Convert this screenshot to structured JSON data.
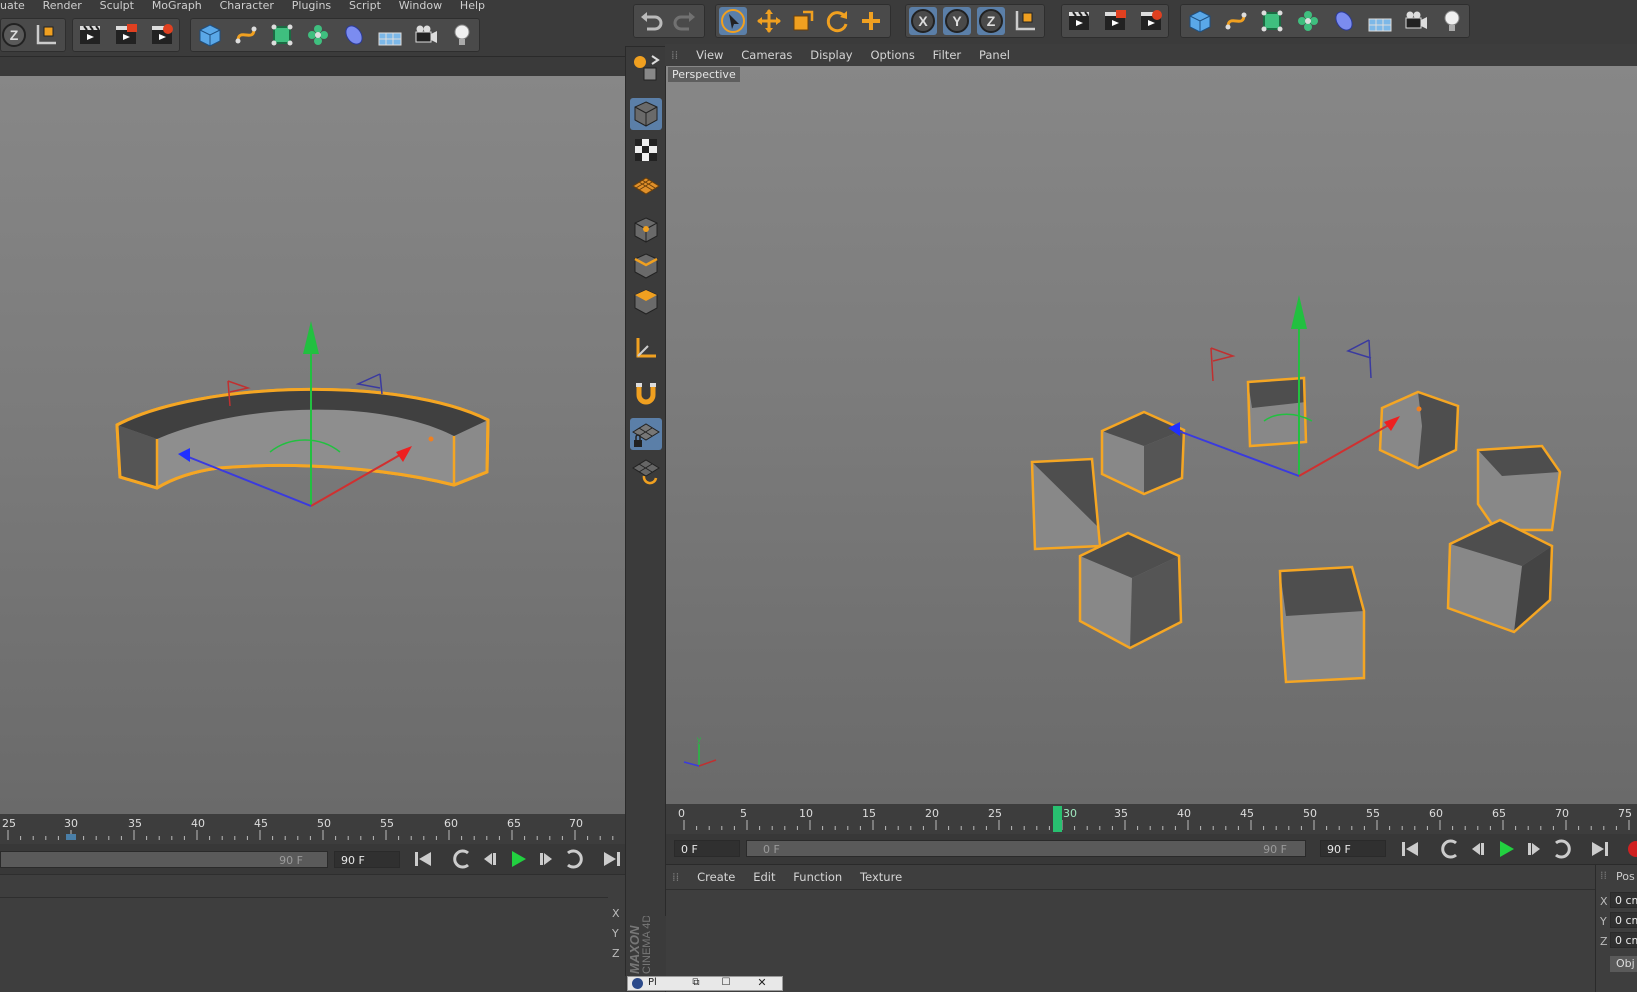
{
  "menu": {
    "items": [
      "uate",
      "Render",
      "Sculpt",
      "MoGraph",
      "Character",
      "Plugins",
      "Script",
      "Window",
      "Help"
    ]
  },
  "left_view": {
    "timeline_ticks": [
      "25",
      "30",
      "35",
      "40",
      "45",
      "50",
      "55",
      "60",
      "65",
      "70"
    ],
    "end_frame_field": "90 F",
    "range_end_label": "90 F"
  },
  "right_view": {
    "menu": [
      "View",
      "Cameras",
      "Display",
      "Options",
      "Filter",
      "Panel"
    ],
    "viewport_label": "Perspective",
    "timeline_ticks": [
      "0",
      "5",
      "10",
      "15",
      "20",
      "25",
      "30",
      "35",
      "40",
      "45",
      "50",
      "55",
      "60",
      "65",
      "70",
      "75"
    ],
    "current_frame": "30",
    "start_frame_field": "0 F",
    "range_start_label": "0 F",
    "range_end_label": "90 F",
    "end_frame_field": "90 F"
  },
  "material_panel": {
    "menu": [
      "Create",
      "Edit",
      "Function",
      "Texture"
    ]
  },
  "coords": {
    "header": "Pos",
    "rows": [
      {
        "axis": "X",
        "value": "0 cm"
      },
      {
        "axis": "Y",
        "value": "0 cm"
      },
      {
        "axis": "Z",
        "value": "0 cm"
      }
    ],
    "button": "Obj"
  },
  "left_coords": [
    "X",
    "Y",
    "Z"
  ],
  "brand": {
    "line1": "MAXON",
    "line2": "CINEMA 4D"
  },
  "taskbar": {
    "label": "Pl"
  },
  "colors": {
    "selection": "#f5a623",
    "accent": "#f0a020",
    "axis_x": "#d03030",
    "axis_y": "#22c040",
    "axis_z": "#3a3adf"
  }
}
